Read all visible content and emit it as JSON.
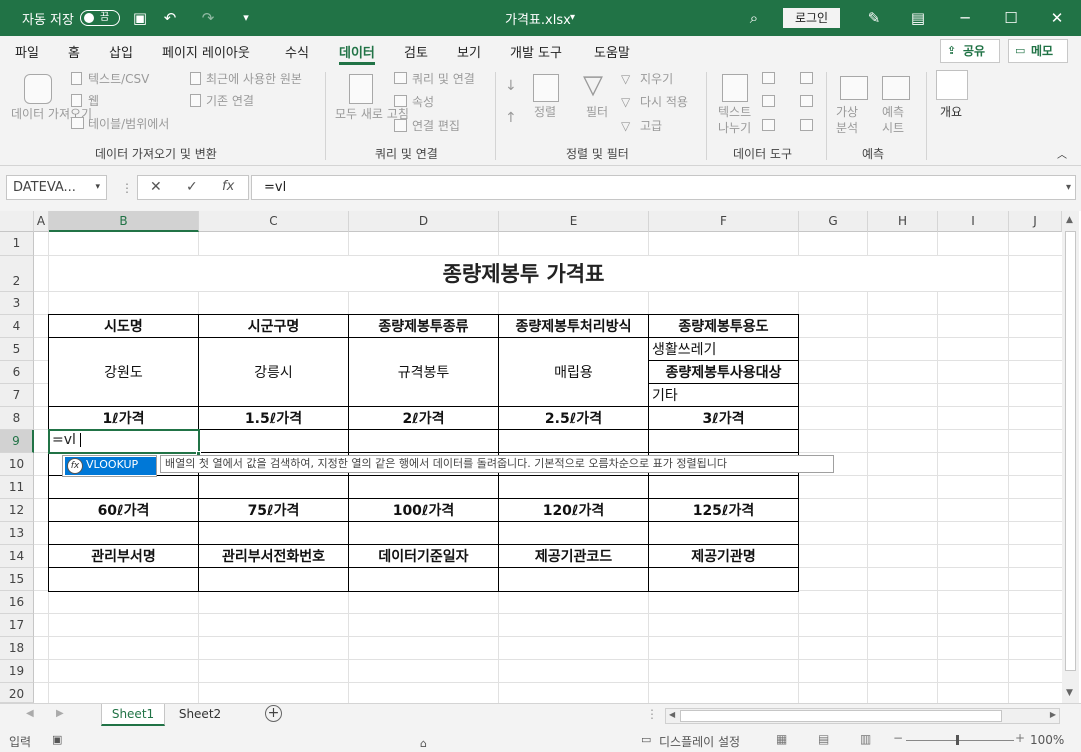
{
  "titlebar": {
    "autosave_label": "자동 저장",
    "autosave_state": "끔",
    "file_name": "가격표.xlsx",
    "login_label": "로그인",
    "accent_color": "#217346"
  },
  "ribbon_tabs": [
    "파일",
    "홈",
    "삽입",
    "페이지 레이아웃",
    "수식",
    "데이터",
    "검토",
    "보기",
    "개발 도구",
    "도움말"
  ],
  "share_label": "공유",
  "memo_label": "메모",
  "ribbon": {
    "get_data": "데이터 가져오기",
    "text_csv": "텍스트/CSV",
    "web": "웹",
    "table_range": "테이블/범위에서",
    "recent_sources": "최근에 사용한 원본",
    "existing_conn": "기존 연결",
    "refresh_all": "모두 새로 고침",
    "queries_conn": "쿼리 및 연결",
    "properties": "속성",
    "edit_links": "연결 편집",
    "sort": "정렬",
    "filter": "필터",
    "clear": "지우기",
    "reapply": "다시 적용",
    "advanced": "고급",
    "text_to_cols": "텍스트 나누기",
    "whatif": "가상 분석",
    "forecast_sheet": "예측 시트",
    "outline": "개요",
    "group1": "데이터 가져오기 및 변환",
    "group2": "쿼리 및 연결",
    "group3": "정렬 및 필터",
    "group4": "데이터 도구",
    "group5": "예측"
  },
  "formula_bar": {
    "name_box": "DATEVA...",
    "formula": "=vl"
  },
  "columns": [
    "A",
    "B",
    "C",
    "D",
    "E",
    "F",
    "G",
    "H",
    "I",
    "J"
  ],
  "rows": [
    "1",
    "2",
    "3",
    "4",
    "5",
    "6",
    "7",
    "8",
    "9",
    "10",
    "11",
    "12",
    "13",
    "14",
    "15",
    "16",
    "17",
    "18",
    "19",
    "20"
  ],
  "sheet": {
    "title": "종량제봉투 가격표",
    "r4": [
      "시도명",
      "시군구명",
      "종량제봉투종류",
      "종량제봉투처리방식",
      "종량제봉투용도"
    ],
    "r5_f": "생활쓰레기",
    "r6_f": "종량제봉투사용대상",
    "r7_f": "기타",
    "merged": [
      "강원도",
      "강릉시",
      "규격봉투",
      "매립용"
    ],
    "r8": [
      "1ℓ가격",
      "1.5ℓ가격",
      "2ℓ가격",
      "2.5ℓ가격",
      "3ℓ가격"
    ],
    "r12": [
      "60ℓ가격",
      "75ℓ가격",
      "100ℓ가격",
      "120ℓ가격",
      "125ℓ가격"
    ],
    "r14": [
      "관리부서명",
      "관리부서전화번호",
      "데이터기준일자",
      "제공기관코드",
      "제공기관명"
    ],
    "editing_value": "=vl"
  },
  "autocomplete": {
    "function": "VLOOKUP",
    "tooltip": "배열의 첫 열에서 값을 검색하여, 지정한 열의 같은 행에서 데이터를 돌려줍니다. 기본적으로 오름차순으로 표가 정렬됩니다"
  },
  "sheet_tabs": [
    "Sheet1",
    "Sheet2"
  ],
  "status": {
    "mode": "입력",
    "display_settings": "디스플레이 설정",
    "zoom": "100%"
  }
}
